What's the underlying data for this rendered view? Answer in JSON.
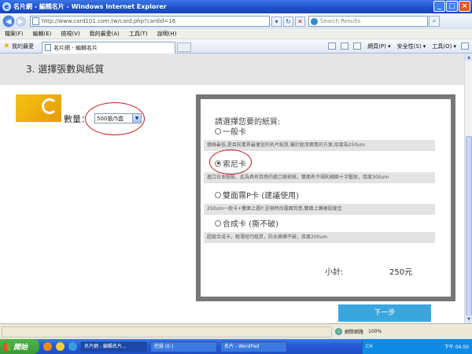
{
  "window": {
    "title": "名片網 - 編輯名片 - Windows Internet Explorer"
  },
  "address": {
    "url": "http://www.card101.com.tw/card.php?cardid=16",
    "search_placeholder": "Search Results"
  },
  "menu": [
    "檔案(F)",
    "編輯(E)",
    "檢視(V)",
    "我的最愛(A)",
    "工具(T)",
    "說明(H)"
  ],
  "favorites": {
    "label": "我的最愛",
    "tab_label": "名片網 - 編輯名片"
  },
  "commands": [
    "網頁(P) ▾",
    "安全性(S) ▾",
    "工具(O) ▾"
  ],
  "page": {
    "step_title": "3. 選擇張數與紙質",
    "quantity_label": "數量：",
    "quantity_value": "500張/5盒",
    "paper": {
      "title": "請選擇您要的紙質:",
      "options": [
        {
          "label": "一般卡",
          "selected": false,
          "desc": "價格最低,是目前業界最便宜的名片紙質,屬於經濟實惠的方案,厚度為250um"
        },
        {
          "label": "索尼卡",
          "selected": true,
          "desc": "進口日本紙紙，此為具有質感的進口美術紙，雙面有不規則細緻十字壓紋，厚度300um"
        },
        {
          "label": "雙面霧P卡 (建議使用)",
          "selected": false,
          "desc": "250um一般卡+雙面上霧P,呈現時尚霧面質感,雙面上膜硬挺度佳"
        },
        {
          "label": "合成卡 (撕不破)",
          "selected": false,
          "desc": "超級合成卡，輕薄短巧紙質，防水撕揮不破，厚度200um"
        }
      ]
    },
    "subtotal_label": "小計:",
    "subtotal_value": "250元",
    "next_label": "下一步"
  },
  "status": {
    "zone": "網際網路",
    "zoom": "100%"
  },
  "taskbar": {
    "start": "開始",
    "items": [
      "名片網 - 編輯名片...",
      "控設 (E:)",
      "名片 - WordPad"
    ],
    "lang": "CH",
    "time": "下午 04:50"
  },
  "colors": {
    "accent": "#3aa6de",
    "highlight_ring": "#c42020"
  }
}
